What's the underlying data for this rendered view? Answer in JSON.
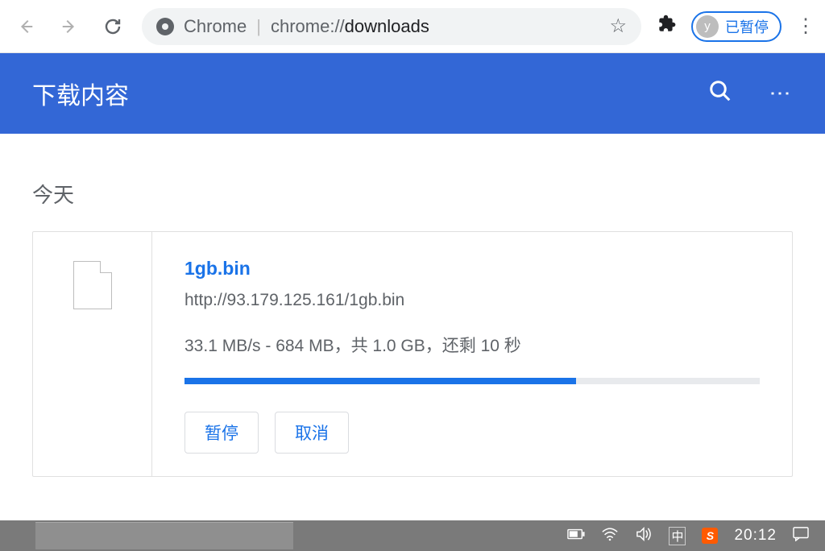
{
  "browser": {
    "omnibox_app": "Chrome",
    "omnibox_url_prefix": "chrome://",
    "omnibox_url_path": "downloads",
    "profile_initial": "y",
    "profile_status": "已暂停"
  },
  "page": {
    "title": "下载内容",
    "section_today": "今天"
  },
  "download": {
    "file_name": "1gb.bin",
    "source_url": "http://93.179.125.161/1gb.bin",
    "status_line": "33.1 MB/s - 684 MB，共 1.0 GB，还剩 10 秒",
    "progress_percent": 68,
    "btn_pause": "暂停",
    "btn_cancel": "取消"
  },
  "taskbar": {
    "ime": "中",
    "sogou": "S",
    "clock": "20:12"
  }
}
